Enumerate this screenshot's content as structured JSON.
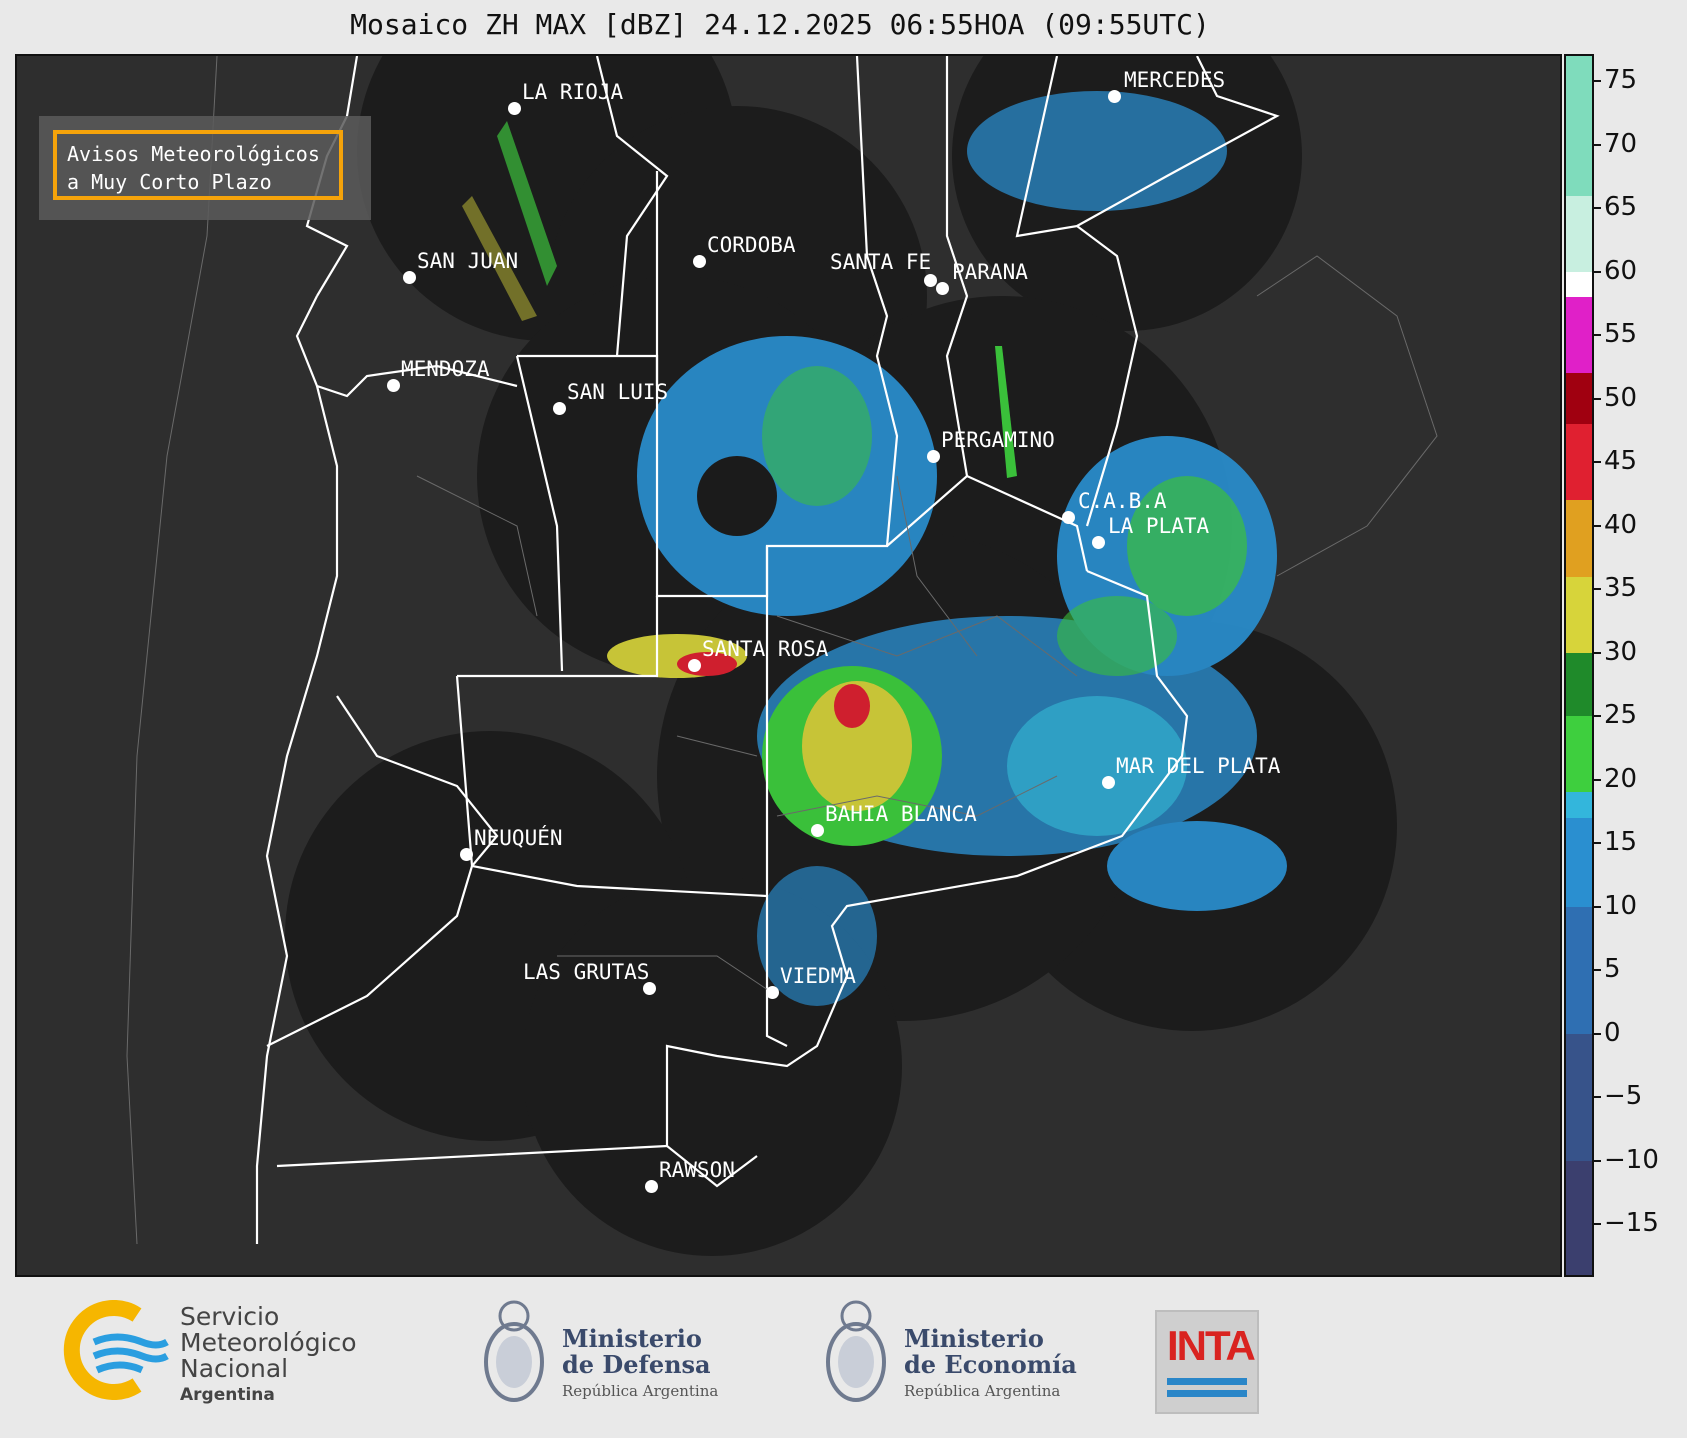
{
  "title": "Mosaico ZH MAX [dBZ] 24.12.2025 06:55HOA (09:55UTC)",
  "avisos": {
    "line1": "Avisos Meteorológicos",
    "line2": "a Muy Corto Plazo"
  },
  "cities": [
    {
      "name": "LA RIOJA"
    },
    {
      "name": "MERCEDES"
    },
    {
      "name": "SAN JUAN"
    },
    {
      "name": "CORDOBA"
    },
    {
      "name": "SANTA FE"
    },
    {
      "name": "PARANA"
    },
    {
      "name": "MENDOZA"
    },
    {
      "name": "SAN LUIS"
    },
    {
      "name": "PERGAMINO"
    },
    {
      "name": "C.A.B.A"
    },
    {
      "name": "LA PLATA"
    },
    {
      "name": "SANTA ROSA"
    },
    {
      "name": "MAR DEL PLATA"
    },
    {
      "name": "BAHIA BLANCA"
    },
    {
      "name": "NEUQUÉN"
    },
    {
      "name": "LAS GRUTAS"
    },
    {
      "name": "VIEDMA"
    },
    {
      "name": "RAWSON"
    }
  ],
  "colorbar": {
    "range": [
      -19,
      77
    ],
    "ticks": [
      "75",
      "70",
      "65",
      "60",
      "55",
      "50",
      "45",
      "40",
      "35",
      "30",
      "25",
      "20",
      "15",
      "10",
      "5",
      "0",
      "−5",
      "−10",
      "−15"
    ],
    "stops": [
      {
        "from": -19,
        "to": -10,
        "color": "#3b3f6e"
      },
      {
        "from": -10,
        "to": 0,
        "color": "#37538a"
      },
      {
        "from": 0,
        "to": 10,
        "color": "#2f6fb2"
      },
      {
        "from": 10,
        "to": 17,
        "color": "#2a8fd0"
      },
      {
        "from": 17,
        "to": 19,
        "color": "#33b6dc"
      },
      {
        "from": 19,
        "to": 25,
        "color": "#3ecf3e"
      },
      {
        "from": 25,
        "to": 30,
        "color": "#1f8a2a"
      },
      {
        "from": 30,
        "to": 36,
        "color": "#d7d43a"
      },
      {
        "from": 36,
        "to": 42,
        "color": "#e0a020"
      },
      {
        "from": 42,
        "to": 48,
        "color": "#e02030"
      },
      {
        "from": 48,
        "to": 52,
        "color": "#a00010"
      },
      {
        "from": 52,
        "to": 58,
        "color": "#e020c8"
      },
      {
        "from": 58,
        "to": 60,
        "color": "#ffffff"
      },
      {
        "from": 60,
        "to": 66,
        "color": "#c8efe0"
      },
      {
        "from": 66,
        "to": 77,
        "color": "#7fdcbc"
      }
    ]
  },
  "logos": {
    "smn": {
      "line1": "Servicio",
      "line2": "Meteorológico",
      "line3": "Nacional",
      "line4": "Argentina"
    },
    "defensa": {
      "line1": "Ministerio",
      "line2": "de Defensa",
      "line3": "República Argentina"
    },
    "economia": {
      "line1": "Ministerio",
      "line2": "de Economía",
      "line3": "República Argentina"
    },
    "inta": {
      "word": "INTA"
    }
  },
  "colors": {
    "map_bg": "#2e2e2e",
    "radar_disk": "#1c1c1c",
    "accent_box": "#f5a30a"
  }
}
